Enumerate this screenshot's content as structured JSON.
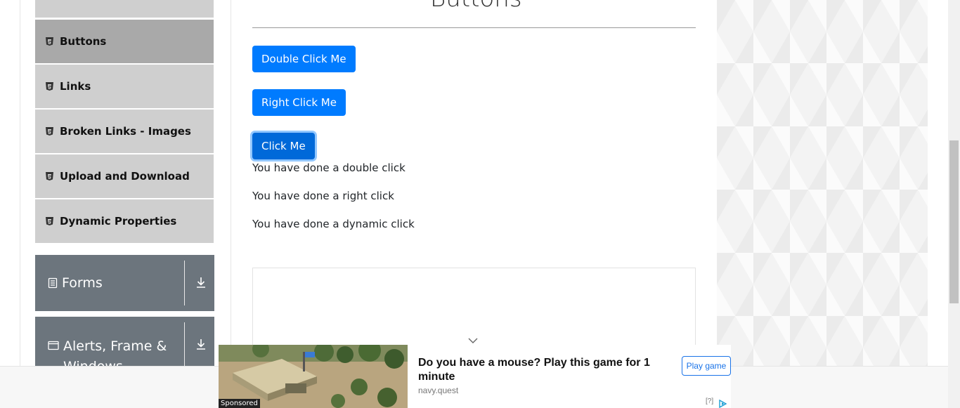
{
  "sidebar": {
    "items": [
      {
        "label": "Buttons",
        "active": true
      },
      {
        "label": "Links"
      },
      {
        "label": "Broken Links - Images"
      },
      {
        "label": "Upload and Download"
      },
      {
        "label": "Dynamic Properties"
      }
    ],
    "groups": [
      {
        "label": "Forms",
        "icon": "document-icon"
      },
      {
        "label": "Alerts, Frame & Windows",
        "icon": "browser-window-icon"
      }
    ]
  },
  "main": {
    "heading": "Buttons",
    "buttons": {
      "double_click": "Double Click Me",
      "right_click": "Right Click Me",
      "click": "Click Me"
    },
    "messages": {
      "double": "You have done a double click",
      "right": "You have done a right click",
      "dynamic": "You have done a dynamic click"
    }
  },
  "ad": {
    "sponsored_label": "Sponsored",
    "title": "Do you have a mouse? Play this game for 1 minute",
    "domain": "navy.quest",
    "cta": "Play game",
    "info": "[?]"
  },
  "colors": {
    "primary": "#007bff",
    "group_bg": "#6c757d",
    "menu_bg": "#cfcfcf",
    "menu_active_bg": "#a9a9a9"
  }
}
